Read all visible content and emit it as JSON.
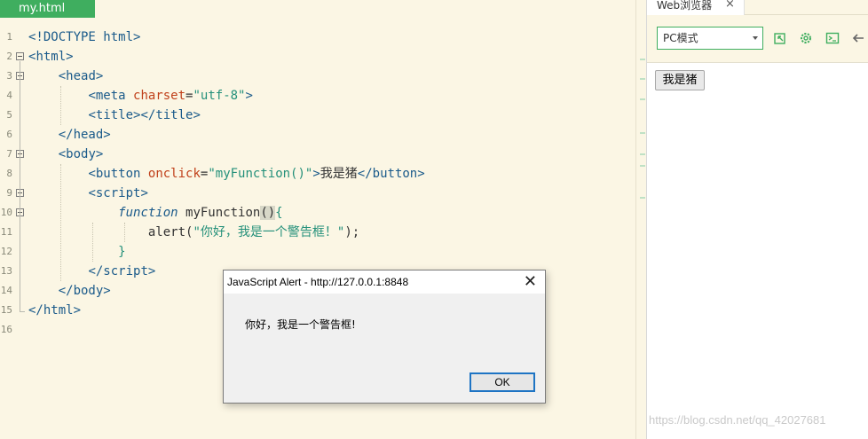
{
  "editor": {
    "file_tab": "my.html",
    "line_numbers": [
      "1",
      "2",
      "3",
      "4",
      "5",
      "6",
      "7",
      "8",
      "9",
      "10",
      "11",
      "12",
      "13",
      "14",
      "15",
      "16"
    ],
    "code": {
      "l1": "<!DOCTYPE html>",
      "l2_tag": "html",
      "l3_tag": "head",
      "l4_tag": "meta",
      "l4_attr": "charset",
      "l4_val": "\"utf-8\"",
      "l5_tag": "title",
      "l6_tag": "head",
      "l7_tag": "body",
      "l8_tag": "button",
      "l8_attr": "onclick",
      "l8_val": "\"myFunction()\"",
      "l8_text": "我是猪",
      "l9_tag": "script",
      "l10_kw": "function",
      "l10_fn": " myFunction",
      "l11_fn": "alert",
      "l11_str": "\"你好，我是一个警告框！\"",
      "l13_tag": "script",
      "l14_tag": "body",
      "l15_tag": "html"
    }
  },
  "browser": {
    "tab_label": "Web浏览器",
    "close_glyph": "×",
    "mode_select_value": "PC模式",
    "page_button_label": "我是猪",
    "watermark": "https://blog.csdn.net/qq_42027681"
  },
  "dialog": {
    "title": "JavaScript Alert - http://127.0.0.1:8848",
    "close_glyph": "✕",
    "message": "你好，我是一个警告框!",
    "ok_label": "OK"
  },
  "colors": {
    "accent": "#3fae5f",
    "editor_bg": "#fbf6e4",
    "tag": "#1a5a8a",
    "attr": "#c0401a",
    "string": "#24907a",
    "dialog_focus": "#1e74c4"
  },
  "icons": [
    "external-link-icon",
    "gear-icon",
    "terminal-icon",
    "back-arrow-icon"
  ]
}
